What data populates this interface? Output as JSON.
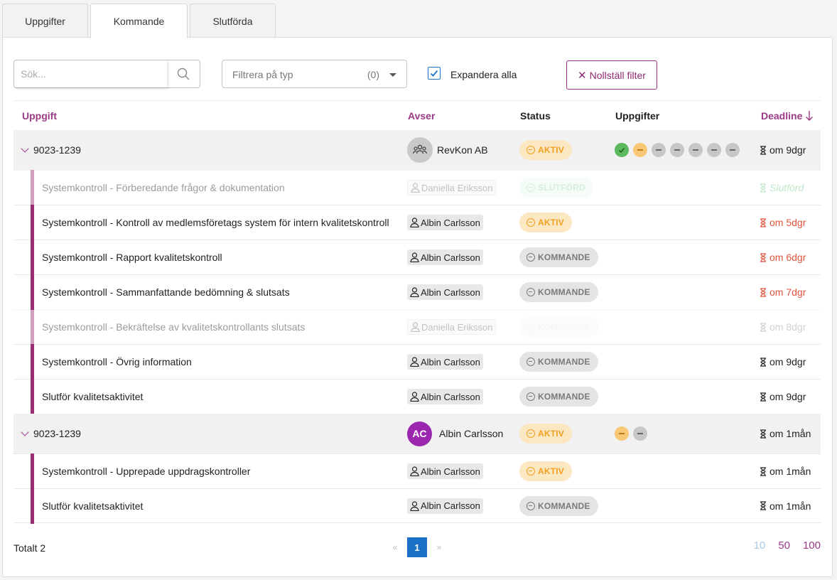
{
  "tabs": [
    "Uppgifter",
    "Kommande",
    "Slutförda"
  ],
  "toolbar": {
    "search_placeholder": "Sök...",
    "filter_label": "Filtrera på typ",
    "filter_count": "(0)",
    "expand_label": "Expandera alla",
    "expand_checked": true,
    "reset_label": "Nollställ filter"
  },
  "columns": {
    "task": "Uppgift",
    "avser": "Avser",
    "status": "Status",
    "tasks": "Uppgifter",
    "deadline": "Deadline"
  },
  "groups": [
    {
      "id": "9023-1239",
      "owner": "RevKon AB",
      "owner_avatar": "group-icon",
      "status": "AKTIV",
      "task_dots": [
        "done",
        "active",
        "pending",
        "pending",
        "pending",
        "pending",
        "pending"
      ],
      "deadline": "om 9dgr",
      "children": [
        {
          "title": "Systemkontroll - Förberedande frågor & dokumentation",
          "user": "Daniella Eriksson",
          "status": "SLUTFÖRD",
          "deadline": "Slutförd",
          "faded": true
        },
        {
          "title": "Systemkontroll - Kontroll av medlemsföretags system för intern kvalitetskontroll",
          "user": "Albin Carlsson",
          "status": "AKTIV",
          "deadline": "om 5dgr"
        },
        {
          "title": "Systemkontroll - Rapport kvalitetskontroll",
          "user": "Albin Carlsson",
          "status": "KOMMANDE",
          "deadline": "om 6dgr"
        },
        {
          "title": "Systemkontroll - Sammanfattande bedömning & slutsats",
          "user": "Albin Carlsson",
          "status": "KOMMANDE",
          "deadline": "om 7dgr"
        },
        {
          "title": "Systemkontroll - Bekräftelse av kvalitetskontrollants slutsats",
          "user": "Daniella Eriksson",
          "status": "KOMMANDE",
          "deadline": "om 8dgr",
          "faded": true
        },
        {
          "title": "Systemkontroll - Övrig information",
          "user": "Albin Carlsson",
          "status": "KOMMANDE",
          "deadline": "om 9dgr"
        },
        {
          "title": "Slutför kvalitetsaktivitet",
          "user": "Albin Carlsson",
          "status": "KOMMANDE",
          "deadline": "om 9dgr"
        }
      ]
    },
    {
      "id": "9023-1239",
      "owner": "Albin Carlsson",
      "owner_initials": "AC",
      "status": "AKTIV",
      "task_dots": [
        "active",
        "pending"
      ],
      "deadline": "om 1mån",
      "children": [
        {
          "title": "Systemkontroll - Upprepade uppdragskontroller",
          "user": "Albin Carlsson",
          "status": "AKTIV",
          "deadline": "om 1mån"
        },
        {
          "title": "Slutför kvalitetsaktivitet",
          "user": "Albin Carlsson",
          "status": "KOMMANDE",
          "deadline": "om 1mån"
        }
      ]
    }
  ],
  "footer": {
    "total": "Totalt 2",
    "prev": "«",
    "page": "1",
    "next": "»",
    "page_sizes": [
      "10",
      "50",
      "100"
    ],
    "current_size": "10"
  },
  "colors": {
    "accent": "#9b3a86",
    "aktiv": "#f0a020",
    "kommande": "#7a7a7a",
    "overdue": "#e0543b",
    "page": "#1a6fc6"
  }
}
